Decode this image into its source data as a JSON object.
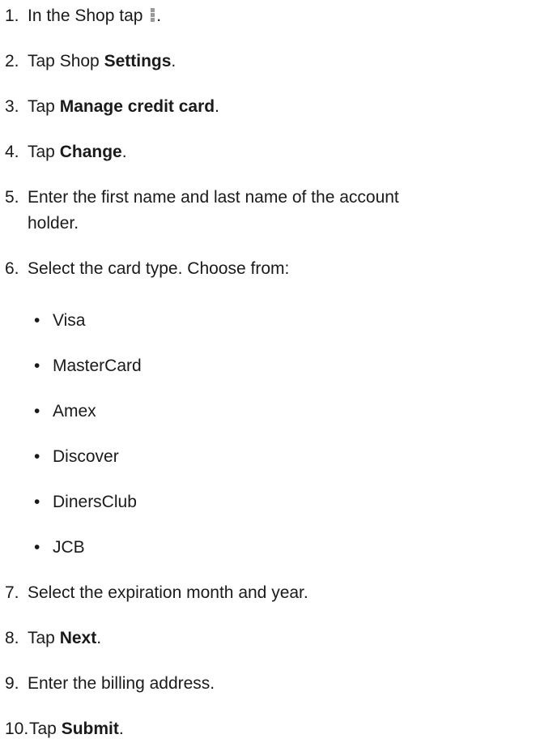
{
  "steps": [
    {
      "num": "1.",
      "pre": "In the Shop tap",
      "post": "."
    },
    {
      "num": "2.",
      "pre": "Tap Shop ",
      "bold": "Settings",
      "post": "."
    },
    {
      "num": "3.",
      "pre": "Tap ",
      "bold": "Manage credit card",
      "post": "."
    },
    {
      "num": "4.",
      "pre": "Tap ",
      "bold": "Change",
      "post": "."
    },
    {
      "num": "5.",
      "line1": "Enter the first name and last name of the account",
      "line2": "holder."
    },
    {
      "num": "6.",
      "text": "Select the card type. Choose from:"
    },
    {
      "num": "7.",
      "text": "Select the expiration month and year."
    },
    {
      "num": "8.",
      "pre": "Tap ",
      "bold": "Next",
      "post": "."
    },
    {
      "num": "9.",
      "text": "Enter the billing address."
    },
    {
      "num": "10.",
      "pre": "Tap ",
      "bold": "Submit",
      "post": "."
    }
  ],
  "card_types": [
    "Visa",
    "MasterCard",
    "Amex",
    "Discover",
    "DinersClub",
    "JCB"
  ],
  "bullet_char": "•",
  "icons": {
    "more": "kebab-menu-icon"
  }
}
